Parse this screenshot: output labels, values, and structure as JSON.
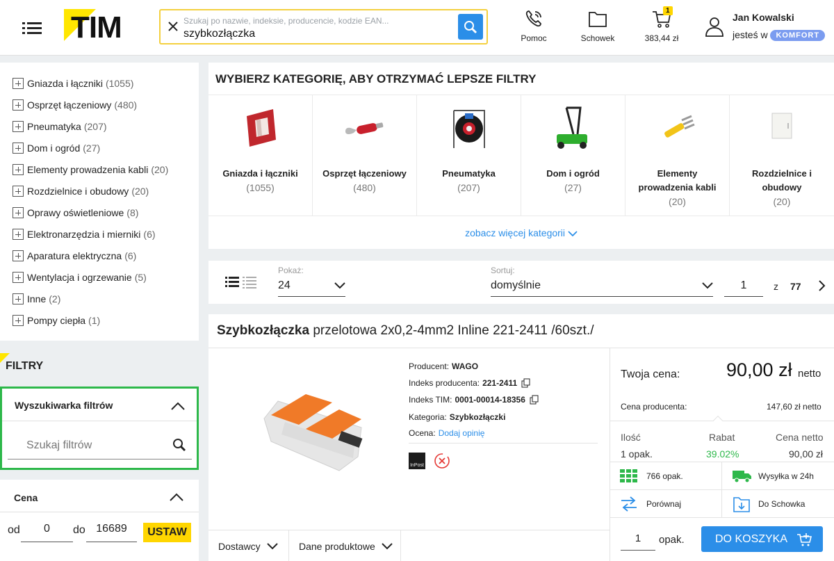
{
  "header": {
    "logo_text": "TIM",
    "search": {
      "placeholder": "Szukaj po nazwie, indeksie, producencie, kodzie EAN...",
      "value": "szybkozłączka"
    },
    "help_label": "Pomoc",
    "storage_label": "Schowek",
    "cart_total": "383,44 zł",
    "cart_count": "1",
    "user_name": "Jan Kowalski",
    "user_level_prefix": "jesteś w",
    "user_level_badge": "KOMFORT"
  },
  "sidebar": {
    "categories": [
      {
        "label": "Gniazda i łączniki",
        "count": "(1055)"
      },
      {
        "label": "Osprzęt łączeniowy",
        "count": "(480)"
      },
      {
        "label": "Pneumatyka",
        "count": "(207)"
      },
      {
        "label": "Dom i ogród",
        "count": "(27)"
      },
      {
        "label": "Elementy prowadzenia kabli",
        "count": "(20)"
      },
      {
        "label": "Rozdzielnice i obudowy",
        "count": "(20)"
      },
      {
        "label": "Oprawy oświetleniowe",
        "count": "(8)"
      },
      {
        "label": "Elektronarzędzia i mierniki",
        "count": "(6)"
      },
      {
        "label": "Aparatura elektryczna",
        "count": "(6)"
      },
      {
        "label": "Wentylacja i ogrzewanie",
        "count": "(5)"
      },
      {
        "label": "Inne",
        "count": "(2)"
      },
      {
        "label": "Pompy ciepła",
        "count": "(1)"
      }
    ],
    "filters_heading": "FILTRY",
    "filter_search_title": "Wyszukiwarka filtrów",
    "filter_search_placeholder": "Szukaj filtrów",
    "price_title": "Cena",
    "price_from_label": "od",
    "price_from": "0",
    "price_to_label": "do",
    "price_to": "16689",
    "price_apply": "USTAW"
  },
  "category_panel": {
    "heading": "WYBIERZ KATEGORIĘ, ABY OTRZYMAĆ LEPSZE FILTRY",
    "tiles": [
      {
        "name": "Gniazda i łączniki",
        "count": "(1055)"
      },
      {
        "name": "Osprzęt łączeniowy",
        "count": "(480)"
      },
      {
        "name": "Pneumatyka",
        "count": "(207)"
      },
      {
        "name": "Dom i ogród",
        "count": "(27)"
      },
      {
        "name": "Elementy prowadzenia kabli",
        "count": "(20)"
      },
      {
        "name": "Rozdzielnice i obudowy",
        "count": "(20)"
      }
    ],
    "more_link": "zobacz więcej kategorii"
  },
  "sortbar": {
    "show_label": "Pokaż:",
    "show_value": "24",
    "sort_label": "Sortuj:",
    "sort_value": "domyślnie",
    "page": "1",
    "of_label": "z",
    "total_pages": "77"
  },
  "product": {
    "title_bold": "Szybkozłączka",
    "title_rest": " przelotowa 2x0,2-4mm2 Inline 221-2411 /60szt./",
    "producer_label": "Producent:",
    "producer": "WAGO",
    "producer_index_label": "Indeks producenta:",
    "producer_index": "221-2411",
    "tim_index_label": "Indeks TIM:",
    "tim_index": "0001-00014-18356",
    "category_label": "Kategoria:",
    "category": "Szybkozłączki",
    "rating_label": "Ocena:",
    "rating_link": "Dodaj opinię",
    "inpost_label": "InPost",
    "tab_suppliers": "Dostawcy",
    "tab_data": "Dane produktowe",
    "your_price_label": "Twoja cena:",
    "your_price": "90,00 zł",
    "your_price_suffix": "netto",
    "producer_price_label": "Cena producenta:",
    "producer_price": "147,60 zł netto",
    "col_qty": "Ilość",
    "col_discount": "Rabat",
    "col_net": "Cena netto",
    "row_qty": "1 opak.",
    "row_discount": "39.02%",
    "row_net": "90,00 zł",
    "stock": "766 opak.",
    "shipping": "Wysyłka w 24h",
    "compare": "Porównaj",
    "to_storage": "Do Schowka",
    "qty_value": "1",
    "qty_unit": "opak.",
    "add_to_cart": "DO KOSZYKA"
  },
  "colors": {
    "accent_yellow": "#ffd600",
    "primary_blue": "#2b8ee8",
    "discount_green": "#2db84a",
    "komfort_badge": "#7b9cf0"
  }
}
